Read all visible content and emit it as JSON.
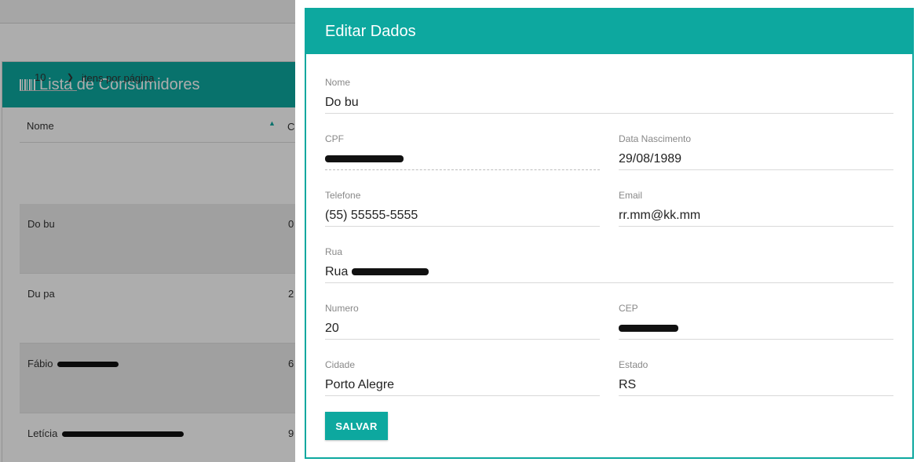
{
  "list": {
    "title": "Lista de Consumidores",
    "per_page_value": "10",
    "per_page_label": "itens por página",
    "header_name": "Nome",
    "header_second": "C",
    "rows": [
      {
        "name": "Do bu",
        "second": "0"
      },
      {
        "name": "Du pa",
        "second": "2"
      },
      {
        "name": "Fábio",
        "second": "6"
      },
      {
        "name": "Letícia",
        "second": "9"
      }
    ]
  },
  "dialog": {
    "title": "Editar Dados",
    "fields": {
      "nome": {
        "label": "Nome",
        "value": "Do bu"
      },
      "cpf": {
        "label": "CPF",
        "value": ""
      },
      "data_nascimento": {
        "label": "Data Nascimento",
        "value": "29/08/1989"
      },
      "telefone": {
        "label": "Telefone",
        "value": "(55) 55555-5555"
      },
      "email": {
        "label": "Email",
        "value": "rr.mm@kk.mm"
      },
      "rua": {
        "label": "Rua",
        "value": "Rua"
      },
      "numero": {
        "label": "Numero",
        "value": "20"
      },
      "cep": {
        "label": "CEP",
        "value": ""
      },
      "cidade": {
        "label": "Cidade",
        "value": "Porto Alegre"
      },
      "estado": {
        "label": "Estado",
        "value": "RS"
      }
    },
    "save_label": "SALVAR"
  },
  "colors": {
    "accent": "#0da89f"
  }
}
